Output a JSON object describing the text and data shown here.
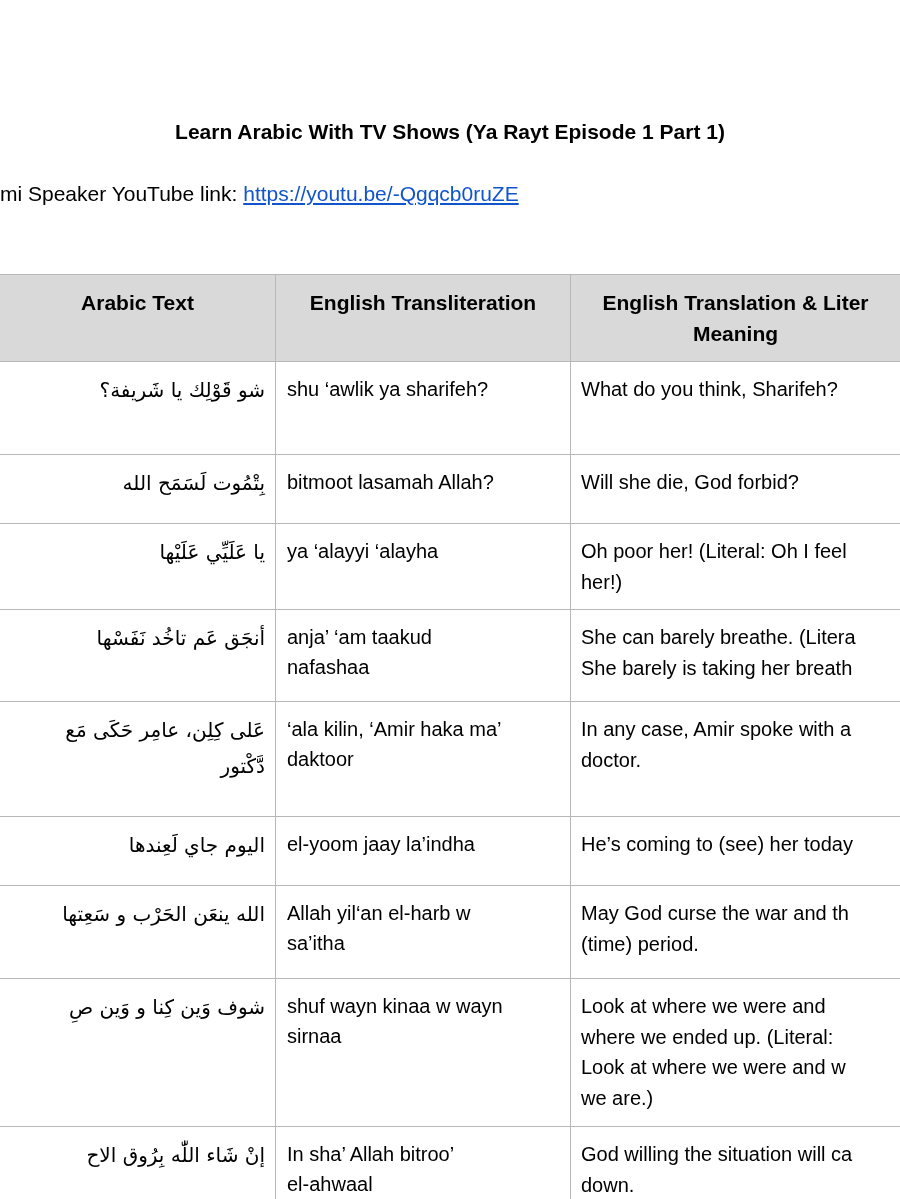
{
  "title": "Learn Arabic With TV Shows (Ya Rayt Episode 1 Part 1)",
  "link_line": {
    "label": "mi Speaker YouTube link: ",
    "url": "https://youtu.be/-Qgqcb0ruZE"
  },
  "table": {
    "columns": [
      "Arabic Text",
      "English Transliteration",
      [
        "English Translation & Liter",
        "Meaning"
      ]
    ],
    "rows": [
      {
        "arabic": [
          "شو قَوْلِك يا شَريفة؟"
        ],
        "transliteration": [
          "shu ‘awlik ya sharifeh?"
        ],
        "translation": [
          "What do you think, Sharifeh?"
        ]
      },
      {
        "arabic": [
          "بِتْمُوت لَسَمَح الله"
        ],
        "transliteration": [
          "bitmoot lasamah Allah?"
        ],
        "translation": [
          "Will she die, God forbid?"
        ]
      },
      {
        "arabic": [
          "يا عَلَيِّي عَلَيْها"
        ],
        "transliteration": [
          "ya ‘alayyi ‘alayha"
        ],
        "translation": [
          "Oh poor her! (Literal: Oh I feel",
          "her!)"
        ]
      },
      {
        "arabic": [
          "أنجَق عَم تاخُد نَفَسْها"
        ],
        "transliteration": [
          "anja’ ‘am taakud",
          "nafashaa"
        ],
        "translation": [
          "She can barely breathe. (Litera",
          "She barely is taking her breath"
        ]
      },
      {
        "arabic": [
          "عَلى كِلِن، عامِر حَكَى مَع",
          "دَّكْتور"
        ],
        "transliteration": [
          "‘ala kilin, ‘Amir haka ma’",
          "daktoor"
        ],
        "translation": [
          "In any case, Amir spoke with a",
          "doctor."
        ]
      },
      {
        "arabic": [
          "اليوم جاي لَعِندها"
        ],
        "transliteration": [
          "el-yoom jaay la’indha"
        ],
        "translation": [
          "He’s coming to (see) her today"
        ]
      },
      {
        "arabic": [
          "الله ينعَن الحَرْب و سَعِتها"
        ],
        "transliteration": [
          "Allah yil‘an el-harb w",
          "sa’itha"
        ],
        "translation": [
          "May God curse the war and th",
          "(time) period."
        ]
      },
      {
        "arabic": [
          "شوف وَين كِنا و وَين صِ"
        ],
        "transliteration": [
          "shuf wayn kinaa w wayn",
          "sirnaa"
        ],
        "translation": [
          "Look at where we were and",
          "where we ended up. (Literal:",
          "Look at where we were and w",
          "we are.)"
        ]
      },
      {
        "arabic": [
          "إنْ شَاء اللّٰه بِرُوق الاح"
        ],
        "transliteration": [
          "In sha’ Allah bitroo’",
          "el-ahwaal"
        ],
        "translation": [
          "God willing the situation will ca",
          "down."
        ]
      }
    ]
  }
}
